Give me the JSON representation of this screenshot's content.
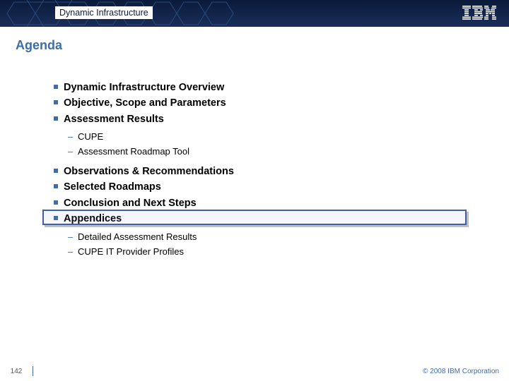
{
  "header": {
    "title": "Dynamic Infrastructure",
    "logo_name": "ibm-logo"
  },
  "slide": {
    "title": "Agenda",
    "highlighted_index": 6
  },
  "bullets": [
    {
      "text": "Dynamic Infrastructure Overview"
    },
    {
      "text": "Objective, Scope and Parameters"
    },
    {
      "text": "Assessment Results",
      "sub": [
        "CUPE",
        "Assessment Roadmap Tool"
      ]
    },
    {
      "text": "Observations & Recommendations"
    },
    {
      "text": "Selected Roadmaps"
    },
    {
      "text": "Conclusion and Next Steps"
    },
    {
      "text": "Appendices",
      "sub": [
        "Detailed Assessment Results",
        "CUPE IT Provider Profiles"
      ]
    }
  ],
  "footer": {
    "page": "142",
    "copyright": "© 2008 IBM Corporation"
  }
}
